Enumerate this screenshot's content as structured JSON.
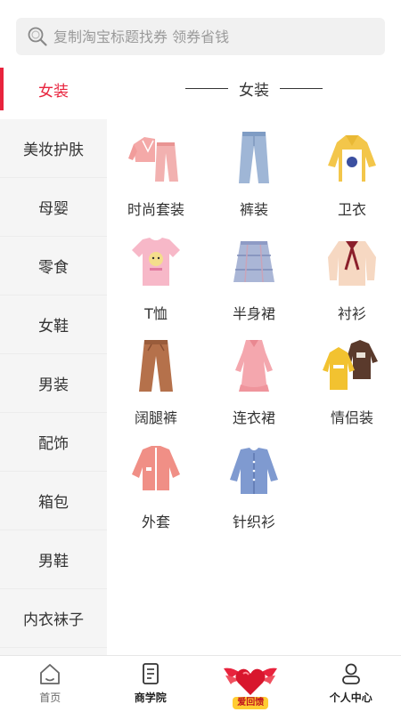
{
  "search": {
    "placeholder": "复制淘宝标题找券 领券省钱"
  },
  "sidebar": {
    "items": [
      {
        "label": "女装",
        "active": true
      },
      {
        "label": "美妆护肤"
      },
      {
        "label": "母婴"
      },
      {
        "label": "零食"
      },
      {
        "label": "女鞋"
      },
      {
        "label": "男装"
      },
      {
        "label": "配饰"
      },
      {
        "label": "箱包"
      },
      {
        "label": "男鞋"
      },
      {
        "label": "内衣袜子"
      }
    ]
  },
  "main": {
    "section_title": "女装",
    "categories": [
      {
        "label": "时尚套装",
        "icon": "pink-tracksuit-image"
      },
      {
        "label": "裤装",
        "icon": "jeans-image"
      },
      {
        "label": "卫衣",
        "icon": "yellow-hoodie-image"
      },
      {
        "label": "T恤",
        "icon": "pink-tshirt-image"
      },
      {
        "label": "半身裙",
        "icon": "plaid-skirt-image"
      },
      {
        "label": "衬衫",
        "icon": "bow-blouse-image"
      },
      {
        "label": "阔腿裤",
        "icon": "brown-wide-pants-image"
      },
      {
        "label": "连衣裙",
        "icon": "pink-dress-image"
      },
      {
        "label": "情侣装",
        "icon": "couple-hoodies-image"
      },
      {
        "label": "外套",
        "icon": "pink-jacket-image"
      },
      {
        "label": "针织衫",
        "icon": "blue-cardigan-image"
      }
    ]
  },
  "tabbar": {
    "tabs": [
      {
        "label": "首页",
        "icon": "home-icon"
      },
      {
        "label": "商学院",
        "icon": "book-icon"
      },
      {
        "label": "爱回馈",
        "icon": "winged-heart-icon"
      },
      {
        "label": "个人中心",
        "icon": "user-icon"
      }
    ]
  },
  "colors": {
    "accent": "#e8233d",
    "sidebar_bg": "#f5f5f5",
    "search_bg": "#f1f1f1"
  }
}
